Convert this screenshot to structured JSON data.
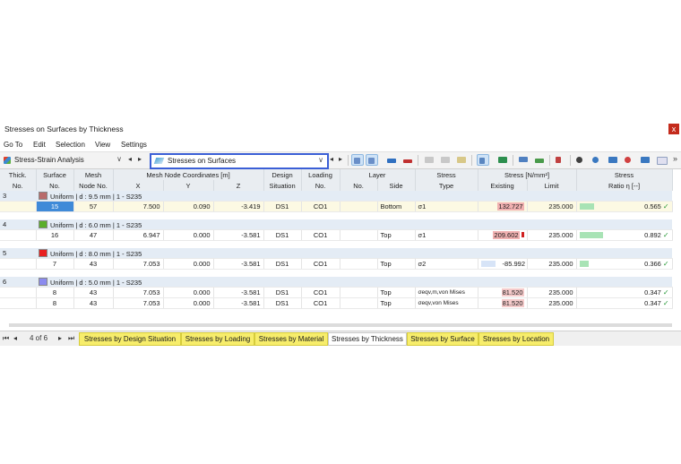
{
  "window": {
    "title": "Stresses on Surfaces by Thickness",
    "close": "x"
  },
  "menu": [
    "Go To",
    "Edit",
    "Selection",
    "View",
    "Settings"
  ],
  "toolbar": {
    "analysis_label": "Stress-Strain Analysis",
    "result_label": "Stresses on Surfaces",
    "prev": "◂",
    "next": "▸",
    "dropdown": "∨",
    "more": "»"
  },
  "columns": {
    "thick": "Thick.",
    "thick2": "No.",
    "surface": "Surface",
    "surface2": "No.",
    "mesh": "Mesh",
    "mesh2": "Node No.",
    "coords": "Mesh Node Coordinates [m]",
    "x": "X",
    "y": "Y",
    "z": "Z",
    "design": "Design",
    "design2": "Situation",
    "loading": "Loading",
    "loading2": "No.",
    "layer": "Layer",
    "layer_no": "No.",
    "side": "Side",
    "stress_type": "Stress",
    "stress_type2": "Type",
    "stress_unit": "Stress [N/mm²]",
    "existing": "Existing",
    "limit": "Limit",
    "ratio": "Stress",
    "ratio2": "Ratio η [--]"
  },
  "groups": [
    {
      "no": "3",
      "color": "#b86b6b",
      "label": "Uniform | d : 9.5 mm | 1 - S235",
      "rows": [
        {
          "surface": "15",
          "node": "57",
          "x": "7.500",
          "y": "0.090",
          "z": "-3.419",
          "ds": "DS1",
          "lc": "CO1",
          "side": "Bottom",
          "type": "σ1",
          "existing": "132.727",
          "limit": "235.000",
          "ratio": "0.565"
        }
      ]
    },
    {
      "no": "4",
      "color": "#5aae2a",
      "label": "Uniform | d : 6.0 mm | 1 - S235",
      "rows": [
        {
          "surface": "16",
          "node": "47",
          "x": "6.947",
          "y": "0.000",
          "z": "-3.581",
          "ds": "DS1",
          "lc": "CO1",
          "side": "Top",
          "type": "σ1",
          "existing": "209.602",
          "limit": "235.000",
          "ratio": "0.892"
        }
      ]
    },
    {
      "no": "5",
      "color": "#e82020",
      "label": "Uniform | d : 8.0 mm | 1 - S235",
      "rows": [
        {
          "surface": "7",
          "node": "43",
          "x": "7.053",
          "y": "0.000",
          "z": "-3.581",
          "ds": "DS1",
          "lc": "CO1",
          "side": "Top",
          "type": "σ2",
          "existing": "-85.992",
          "limit": "235.000",
          "ratio": "0.366"
        }
      ]
    },
    {
      "no": "6",
      "color": "#8b8bef",
      "label": "Uniform | d : 5.0 mm | 1 - S235",
      "rows": [
        {
          "surface": "8",
          "node": "43",
          "x": "7.053",
          "y": "0.000",
          "z": "-3.581",
          "ds": "DS1",
          "lc": "CO1",
          "side": "Top",
          "type": "σeqv,m,von Mises",
          "existing": "81.520",
          "limit": "235.000",
          "ratio": "0.347"
        },
        {
          "surface": "8",
          "node": "43",
          "x": "7.053",
          "y": "0.000",
          "z": "-3.581",
          "ds": "DS1",
          "lc": "CO1",
          "side": "Top",
          "type": "σeqv,von Mises",
          "existing": "81.520",
          "limit": "235.000",
          "ratio": "0.347"
        }
      ]
    }
  ],
  "check": "✓",
  "status": {
    "first": "⏮",
    "prev": "◂",
    "page": "4 of 6",
    "next": "▸",
    "last": "⏭",
    "tabs": [
      "Stresses by Design Situation",
      "Stresses by Loading",
      "Stresses by Material",
      "Stresses by Thickness",
      "Stresses by Surface",
      "Stresses by Location"
    ],
    "active_tab": "Stresses by Thickness"
  }
}
